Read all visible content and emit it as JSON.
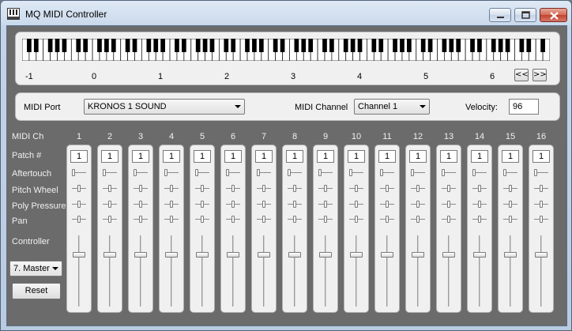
{
  "window": {
    "title": "MQ MIDI Controller",
    "icon": "app-icon"
  },
  "keyboard": {
    "octave_labels": [
      "-1",
      "0",
      "1",
      "2",
      "3",
      "4",
      "5",
      "6"
    ],
    "prev_label": "<<",
    "next_label": ">>"
  },
  "port": {
    "port_label": "MIDI Port",
    "port_value": "KRONOS 1 SOUND",
    "channel_label": "MIDI Channel",
    "channel_value": "Channel 1",
    "velocity_label": "Velocity:",
    "velocity_value": "96"
  },
  "row_labels": {
    "midi_ch": "MIDI Ch",
    "patch": "Patch #",
    "aftertouch": "Aftertouch",
    "pitch_wheel": "Pitch Wheel",
    "poly_pressure": "Poly Pressure",
    "pan": "Pan",
    "controller": "Controller"
  },
  "channels": [
    {
      "number": "1",
      "patch": "1"
    },
    {
      "number": "2",
      "patch": "1"
    },
    {
      "number": "3",
      "patch": "1"
    },
    {
      "number": "4",
      "patch": "1"
    },
    {
      "number": "5",
      "patch": "1"
    },
    {
      "number": "6",
      "patch": "1"
    },
    {
      "number": "7",
      "patch": "1"
    },
    {
      "number": "8",
      "patch": "1"
    },
    {
      "number": "9",
      "patch": "1"
    },
    {
      "number": "10",
      "patch": "1"
    },
    {
      "number": "11",
      "patch": "1"
    },
    {
      "number": "12",
      "patch": "1"
    },
    {
      "number": "13",
      "patch": "1"
    },
    {
      "number": "14",
      "patch": "1"
    },
    {
      "number": "15",
      "patch": "1"
    },
    {
      "number": "16",
      "patch": "1"
    }
  ],
  "slider_levels": {
    "aftertouch": 0.0,
    "pitch_wheel": 0.5,
    "poly_pressure": 0.5,
    "pan": 0.5,
    "controller": 0.75
  },
  "controller_select": {
    "value": "7. Master"
  },
  "reset_label": "Reset"
}
